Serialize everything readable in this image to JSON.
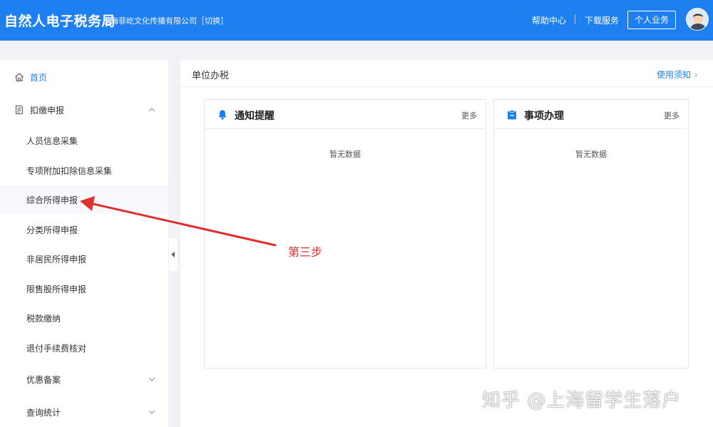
{
  "header": {
    "title": "自然人电子税务局",
    "company": "上海菲屹文化传播有限公司［切换］",
    "help": "帮助中心",
    "download": "下载服务",
    "personal": "个人业务"
  },
  "sidebar": {
    "home": "首页",
    "declare": "扣缴申报",
    "sub_items": [
      "人员信息采集",
      "专项附加扣除信息采集",
      "综合所得申报",
      "分类所得申报",
      "非居民所得申报",
      "限售股所得申报",
      "税款缴纳",
      "退付手续费核对"
    ],
    "preferential": "优惠备案",
    "query": "查询统计"
  },
  "main": {
    "title": "单位办税",
    "notice_link": "使用须知",
    "card_notice": {
      "title": "通知提醒",
      "more": "更多",
      "empty": "暂无数据"
    },
    "card_tasks": {
      "title": "事项办理",
      "more": "更多",
      "empty": "暂无数据"
    }
  },
  "annotation": {
    "step": "第三步"
  },
  "watermark": "知乎 @上海留学生落户",
  "colors": {
    "primary": "#1e7ff0",
    "annotation": "#e02e2e"
  }
}
